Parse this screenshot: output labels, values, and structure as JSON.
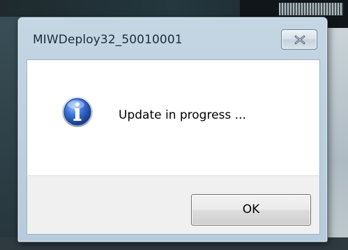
{
  "dialog": {
    "title": "MIWDeploy32_50010001",
    "message": "Update in progress ...",
    "ok_label": "OK",
    "icon": "info-icon",
    "close_icon": "close-icon"
  },
  "colors": {
    "icon_blue": "#2b5fc0",
    "content_bg": "#ffffff",
    "footer_bg": "#f0f0f0"
  }
}
